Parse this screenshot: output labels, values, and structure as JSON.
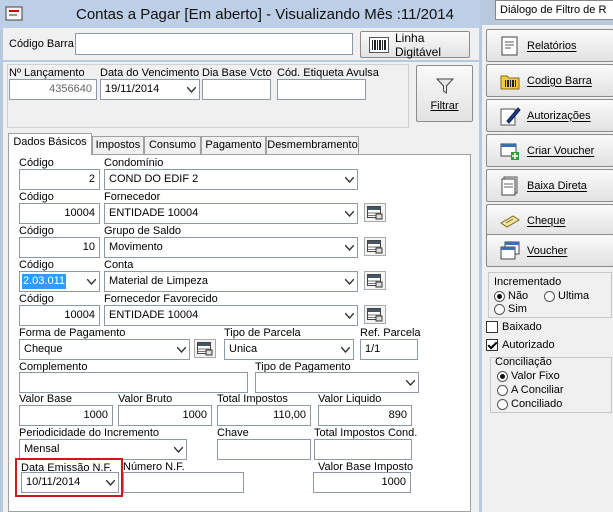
{
  "window": {
    "title": "Contas a Pagar [Em aberto] - Visualizando Mês :11/2014",
    "tooltip": "Diálogo de Filtro de R"
  },
  "top": {
    "barcode_label": "Código Barra",
    "barcode_value": "",
    "linha_digitavel_label": "Linha Digitável",
    "lancamento_label": "Nº Lançamento",
    "lancamento_value": "4356640",
    "vencimento_label": "Data do Vencimento",
    "vencimento_value": "19/11/2014",
    "dia_base_label": "Dia Base Vcto",
    "dia_base_value": "",
    "etiqueta_label": "Cód. Etiqueta Avulsa",
    "etiqueta_value": "",
    "filtrar_label": "Filtrar"
  },
  "tabs": [
    "Dados Básicos",
    "Impostos",
    "Consumo",
    "Pagamento",
    "Desmembramento"
  ],
  "form": {
    "codigo_label": "Código",
    "condominio_label": "Condomínio",
    "condominio_code": "2",
    "condominio_value": "COND DO EDIF 2",
    "fornecedor_label": "Fornecedor",
    "fornecedor_code": "10004",
    "fornecedor_value": "ENTIDADE 10004",
    "grupo_label": "Grupo de Saldo",
    "grupo_code": "10",
    "grupo_value": "Movimento",
    "conta_label": "Conta",
    "conta_code": "2.03.011",
    "conta_value": "Material de Limpeza",
    "fav_label": "Fornecedor Favorecido",
    "fav_code": "10004",
    "fav_value": "ENTIDADE 10004",
    "forma_label": "Forma de Pagamento",
    "forma_value": "Cheque",
    "tipo_parcela_label": "Tipo de Parcela",
    "tipo_parcela_value": "Unica",
    "ref_parcela_label": "Ref. Parcela",
    "ref_parcela_value": "1/1",
    "complemento_label": "Complemento",
    "complemento_value": "",
    "tipo_pagamento_label": "Tipo de Pagamento",
    "tipo_pagamento_value": "",
    "valor_base_label": "Valor Base",
    "valor_base_value": "1000",
    "valor_bruto_label": "Valor Bruto",
    "valor_bruto_value": "1000",
    "total_impostos_label": "Total Impostos",
    "total_impostos_value": "110,00",
    "valor_liquido_label": "Valor Liquido",
    "valor_liquido_value": "890",
    "periodicidade_label": "Periodicidade do Incremento",
    "periodicidade_value": "Mensal",
    "chave_label": "Chave",
    "chave_value": "",
    "total_impostos_cond_label": "Total Impostos Cond.",
    "total_impostos_cond_value": "",
    "data_emissao_label": "Data Emissão N.F.",
    "data_emissao_value": "10/11/2014",
    "numero_nf_label": "Número N.F.",
    "numero_nf_value": "",
    "valor_base_imposto_label": "Valor Base Imposto",
    "valor_base_imposto_value": "1000"
  },
  "sidebar": {
    "buttons": [
      "Relatórios",
      "Codigo Barra",
      "Autorizações",
      "Criar Voucher",
      "Baixa Direta",
      "Cheque",
      "Voucher"
    ],
    "incrementado_label": "Incrementado",
    "incrementado_options": [
      "Não",
      "Ultima",
      "Sim"
    ],
    "baixado_label": "Baixado",
    "autorizado_label": "Autorizado",
    "conciliacao_label": "Conciliação",
    "conciliacao_options": [
      "Valor Fixo",
      "A Conciliar",
      "Conciliado"
    ]
  },
  "colors": {
    "highlight_box": "#cc1a1a",
    "selection": "#3399ff",
    "window_bg": "#b9c9dd"
  }
}
